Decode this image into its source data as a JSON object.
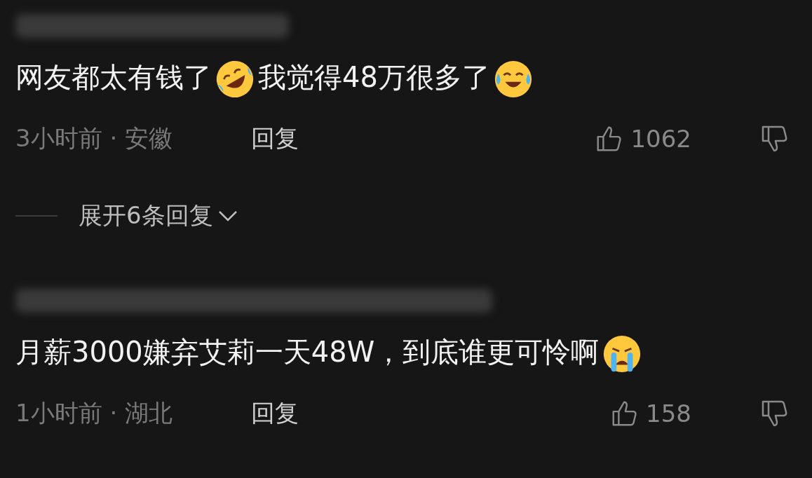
{
  "comments": [
    {
      "segments": [
        {
          "kind": "text",
          "text": "网友都太有钱了"
        },
        {
          "kind": "rofl"
        },
        {
          "kind": "text",
          "text": "我觉得48万很多了"
        },
        {
          "kind": "joy"
        }
      ],
      "meta": "3小时前 · 安徽",
      "reply": "回复",
      "likes": "1062",
      "expand": "展开6条回复"
    },
    {
      "segments": [
        {
          "kind": "text",
          "text": "月薪3000嫌弃艾莉一天48W，到底谁更可怜啊"
        },
        {
          "kind": "cry"
        }
      ],
      "meta": "1小时前 · 湖北",
      "reply": "回复",
      "likes": "158"
    }
  ]
}
